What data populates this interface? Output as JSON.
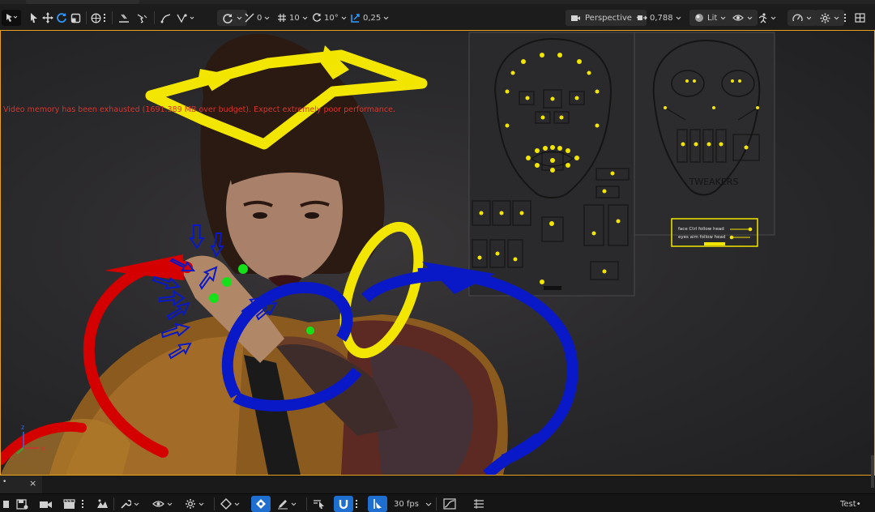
{
  "toolbar": {
    "snap_translate_value": "0",
    "snap_grid_value": "10",
    "snap_rotate_value": "10°",
    "snap_scale_value": "0,25",
    "view_mode_label": "Perspective",
    "camera_speed_value": "0,788",
    "lit_mode_label": "Lit"
  },
  "viewport": {
    "warning_text": "Video memory has been exhausted (1691.389 MB over budget). Expect extremely poor performance.",
    "accent_color": "#e6a21a",
    "control_board_title": "TWEAKERS",
    "toggle_1": "face Ctrl follow head",
    "toggle_2": "eyes aim follow head"
  },
  "sequencer": {
    "close_glyph": "×",
    "fps_label": "30 fps",
    "user_label": "Test•"
  },
  "colors": {
    "ctrl_yellow": "#f2e600",
    "ctrl_red": "#d40000",
    "ctrl_blue": "#0a19c8",
    "ctrl_green": "#16e01a",
    "selected_blue": "#1f6fd1"
  }
}
